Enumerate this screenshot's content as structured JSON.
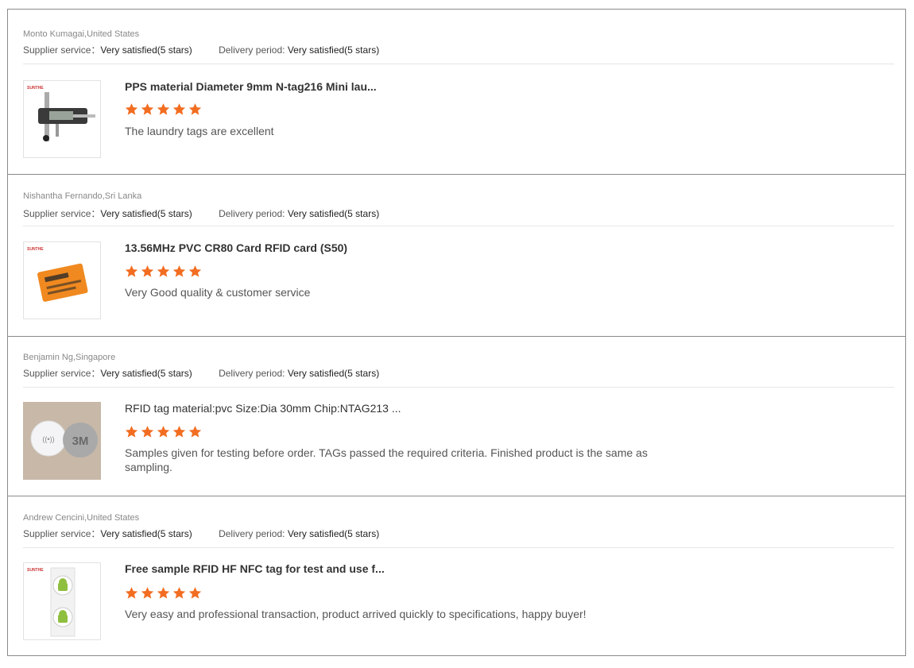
{
  "labels": {
    "supplier_service": "Supplier service：",
    "delivery_period": "Delivery period:"
  },
  "colors": {
    "star": "#f26d21",
    "border": "#8a8a8a",
    "divider": "#e6e6e6"
  },
  "reviews": [
    {
      "reviewer": "Monto Kumagai,United States",
      "supplier_service": "Very satisfied(5 stars)",
      "delivery_period": "Very satisfied(5 stars)",
      "product": "PPS material Diameter 9mm N-tag216 Mini lau...",
      "rating": 5,
      "comment": "The laundry tags are excellent",
      "thumb_icon": "caliper-image"
    },
    {
      "reviewer": "Nishantha Fernando,Sri Lanka",
      "supplier_service": "Very satisfied(5 stars)",
      "delivery_period": "Very satisfied(5 stars)",
      "product": "13.56MHz PVC CR80 Card RFID card (S50)",
      "rating": 5,
      "comment": "Very Good quality & customer service",
      "thumb_icon": "orange-rfid-card-image"
    },
    {
      "reviewer": "Benjamin Ng,Singapore",
      "supplier_service": "Very satisfied(5 stars)",
      "delivery_period": "Very satisfied(5 stars)",
      "product": "RFID tag material:pvc Size:Dia 30mm Chip:NTAG213 ...",
      "rating": 5,
      "comment": "Samples given for testing before order. TAGs passed the required criteria. Finished product is the same as sampling.",
      "thumb_icon": "round-tags-image"
    },
    {
      "reviewer": "Andrew Cencini,United States",
      "supplier_service": "Very satisfied(5 stars)",
      "delivery_period": "Very satisfied(5 stars)",
      "product": "Free sample RFID HF NFC tag for test and use f...",
      "rating": 5,
      "comment": "Very easy and professional transaction, product arrived quickly to specifications, happy buyer!",
      "thumb_icon": "android-nfc-stickers-image"
    }
  ]
}
